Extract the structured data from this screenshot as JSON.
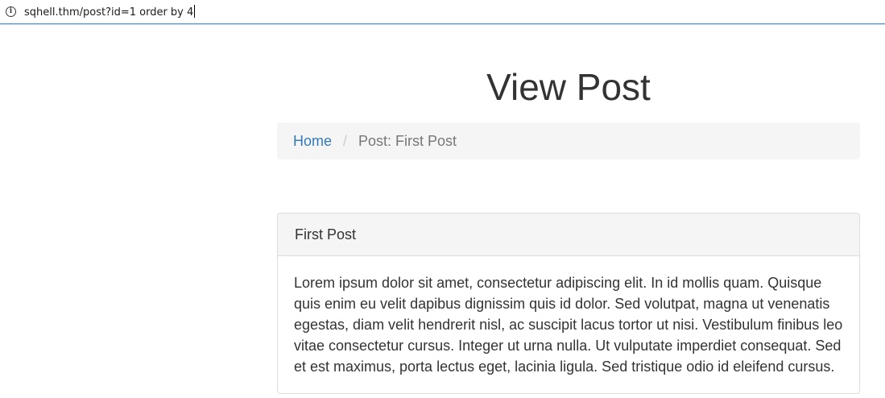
{
  "browser": {
    "url": "sqhell.thm/post?id=1 order by 4",
    "info_icon": "info-icon"
  },
  "page": {
    "title": "View Post"
  },
  "breadcrumb": {
    "home_label": "Home",
    "separator": "/",
    "current": "Post: First Post"
  },
  "post": {
    "title": "First Post",
    "body": "Lorem ipsum dolor sit amet, consectetur adipiscing elit. In id mollis quam. Quisque quis enim eu velit dapibus dignissim quis id dolor. Sed volutpat, magna ut venenatis egestas, diam velit hendrerit nisl, ac suscipit lacus tortor ut nisi. Vestibulum finibus leo vitae consectetur cursus. Integer ut urna nulla. Ut vulputate imperdiet consequat. Sed et est maximus, porta lectus eget, lacinia ligula. Sed tristique odio id eleifend cursus."
  },
  "colors": {
    "link": "#337ab7",
    "muted": "#777777",
    "panel_bg": "#f5f5f5",
    "border": "#dddddd"
  }
}
